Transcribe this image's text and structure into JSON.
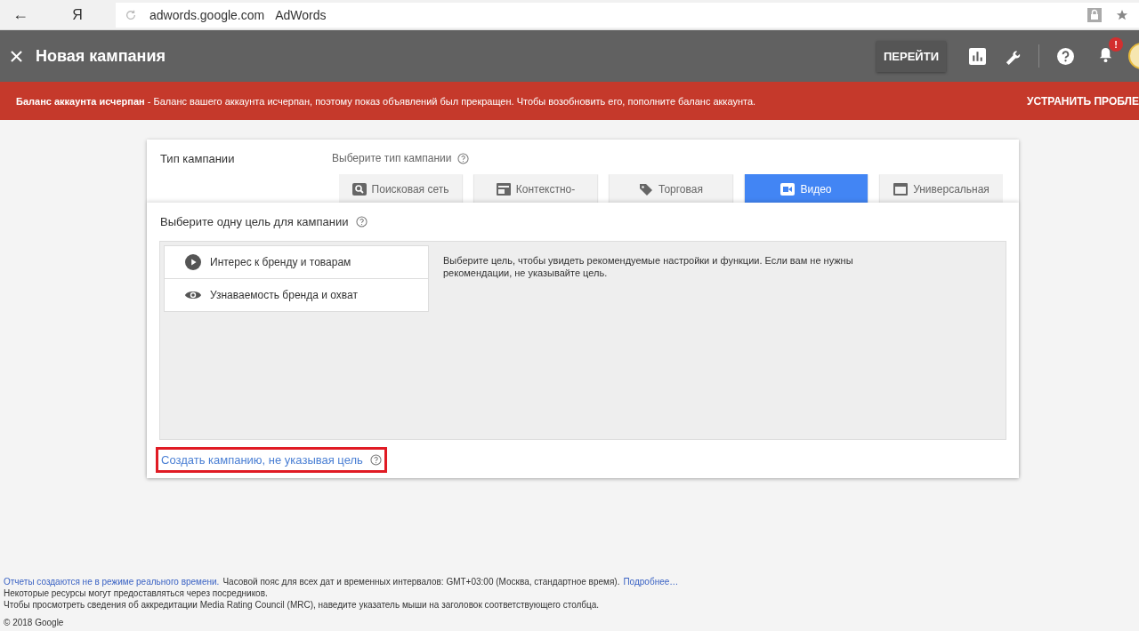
{
  "browser": {
    "back_label": "←",
    "yandex_label": "Я",
    "url": "adwords.google.com",
    "page_title": "AdWords"
  },
  "header": {
    "title": "Новая кампания",
    "go_button": "ПЕРЕЙТИ",
    "notification_badge": "!"
  },
  "alert": {
    "message": "**Баланс аккаунта исчерпан** - Баланс вашего аккаунта исчерпан, поэтому показ объявлений был прекращен. Чтобы возобновить его, пополните баланс аккаунта.",
    "action": "УСТРАНИТЬ ПРОБЛЕ"
  },
  "campaign_type": {
    "label": "Тип кампании",
    "hint": "Выберите тип кампании",
    "tabs": [
      {
        "label": "Поисковая сеть",
        "kind": "search",
        "selected": false
      },
      {
        "label": "Контекстно-",
        "kind": "display",
        "selected": false
      },
      {
        "label": "Торговая",
        "kind": "shopping",
        "selected": false
      },
      {
        "label": "Видео",
        "kind": "video",
        "selected": true
      },
      {
        "label": "Универсальная",
        "kind": "app",
        "selected": false
      }
    ]
  },
  "goal": {
    "title": "Выберите одну цель для кампании",
    "options": [
      {
        "label": "Интерес к бренду и товарам",
        "kind": "play"
      },
      {
        "label": "Узнаваемость бренда и охват",
        "kind": "eye"
      }
    ],
    "description": "Выберите цель, чтобы увидеть рекомендуемые настройки и функции. Если вам не нужны рекомендации, не указывайте цель.",
    "no_goal_link": "Создать кампанию, не указывая цель"
  },
  "footer": {
    "realtime_link": "Отчеты создаются не в режиме реального времени.",
    "timezone": "Часовой пояс для всех дат и временных интервалов: GMT+03:00 (Москва, стандартное время).",
    "more_link": "Подробнее…",
    "line_2": "Некоторые ресурсы могут предоставляться через посредников.",
    "line_3": "Чтобы просмотреть сведения об аккредитации Media Rating Council (MRC), наведите указатель мыши на заголовок соответствующего столбца.",
    "copyright": "© 2018 Google"
  }
}
